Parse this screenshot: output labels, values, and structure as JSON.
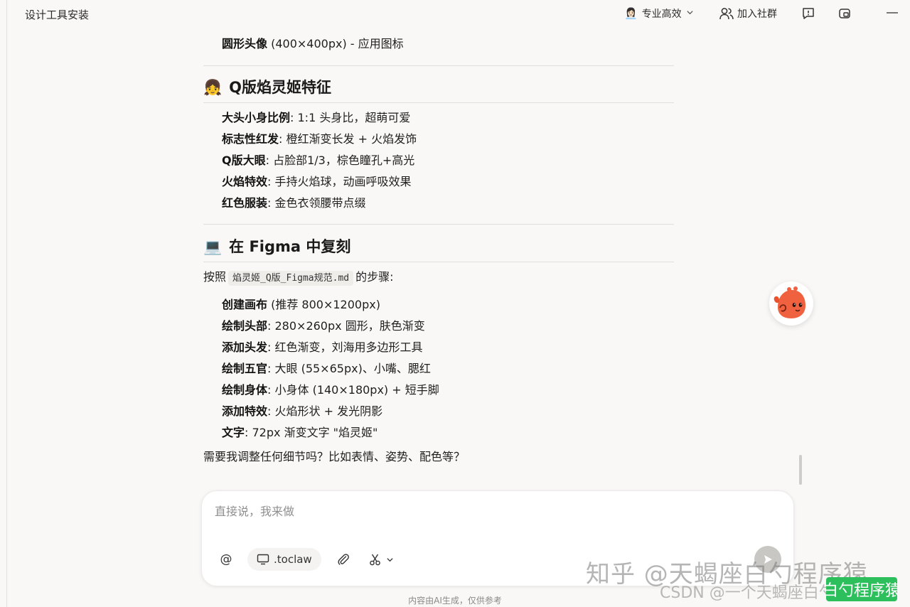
{
  "header": {
    "title": "设计工具安装",
    "mode_emoji": "👩🏻‍💼",
    "mode_label": "专业高效",
    "community_label": "加入社群"
  },
  "content": {
    "top_item": {
      "bold": "圆形头像",
      "text": " (400×400px) - 应用图标"
    },
    "section1": {
      "emoji": "👧",
      "title": "Q版焰灵姬特征",
      "items": [
        {
          "bold": "大头小身比例",
          "text": ": 1:1 头身比，超萌可爱"
        },
        {
          "bold": "标志性红发",
          "text": ": 橙红渐变长发 + 火焰发饰"
        },
        {
          "bold": "Q版大眼",
          "text": ": 占脸部1/3，棕色瞳孔+高光"
        },
        {
          "bold": "火焰特效",
          "text": ": 手持火焰球，动画呼吸效果"
        },
        {
          "bold": "红色服装",
          "text": ": 金色衣领腰带点缀"
        }
      ]
    },
    "section2": {
      "emoji": "💻",
      "title": "在 Figma 中复刻",
      "intro_before": "按照",
      "intro_code": "焰灵姬_Q版_Figma规范.md",
      "intro_after": "的步骤:",
      "items": [
        {
          "bold": "创建画布",
          "text": " (推荐 800×1200px)"
        },
        {
          "bold": "绘制头部",
          "text": ": 280×260px 圆形，肤色渐变"
        },
        {
          "bold": "添加头发",
          "text": ": 红色渐变，刘海用多边形工具"
        },
        {
          "bold": "绘制五官",
          "text": ": 大眼 (55×65px)、小嘴、腮红"
        },
        {
          "bold": "绘制身体",
          "text": ": 小身体 (140×180px) + 短手脚"
        },
        {
          "bold": "添加特效",
          "text": ": 火焰形状 + 发光阴影"
        },
        {
          "bold": "文字",
          "text": ": 72px 渐变文字 \"焰灵姬\""
        }
      ],
      "closing": "需要我调整任何细节吗？比如表情、姿势、配色等？"
    }
  },
  "composer": {
    "placeholder": "直接说，我来做",
    "at_label": "@",
    "context_label": ".toclaw"
  },
  "footer_note": "内容由AI生成，仅供参考",
  "watermarks": {
    "zhihu": "知乎 @天蝎座白勺程序猿",
    "csdn": "CSDN @一个天蝎座白勺程序猿",
    "badge": "白勺程序猿"
  },
  "colors": {
    "background": "#f9f8f7",
    "send_button": "#c9c7c4",
    "badge_green": "#2dbf5c"
  }
}
